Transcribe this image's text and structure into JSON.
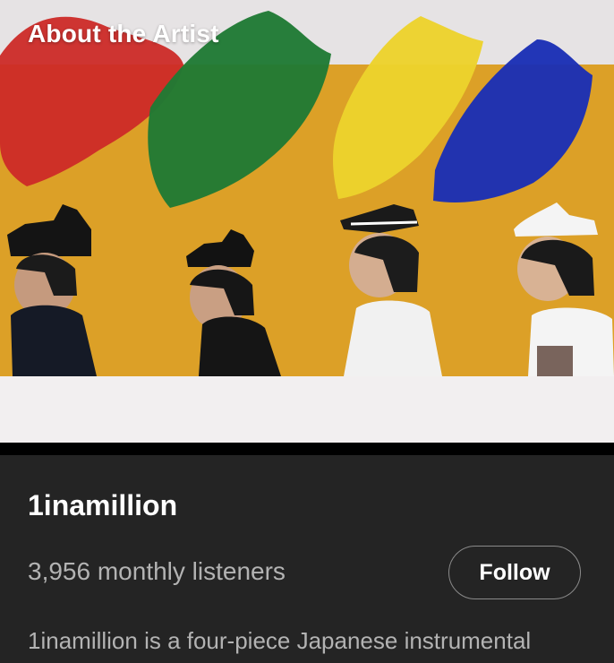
{
  "section": {
    "title": "About the Artist"
  },
  "image": {
    "alt": "",
    "colors": {
      "wall": "#dca027",
      "top_strip": "#e6e3e4",
      "bottom_strip": "#f2eff0",
      "paint_red": "#cc2a27",
      "paint_green": "#1f7a34",
      "paint_yellow": "#ecd32c",
      "paint_blue": "#1a2fb5"
    }
  },
  "artist": {
    "name": "1inamillion",
    "monthly_listeners": "3,956 monthly listeners",
    "bio": "1inamillion is a four-piece Japanese instrumental"
  },
  "actions": {
    "follow_label": "Follow"
  }
}
